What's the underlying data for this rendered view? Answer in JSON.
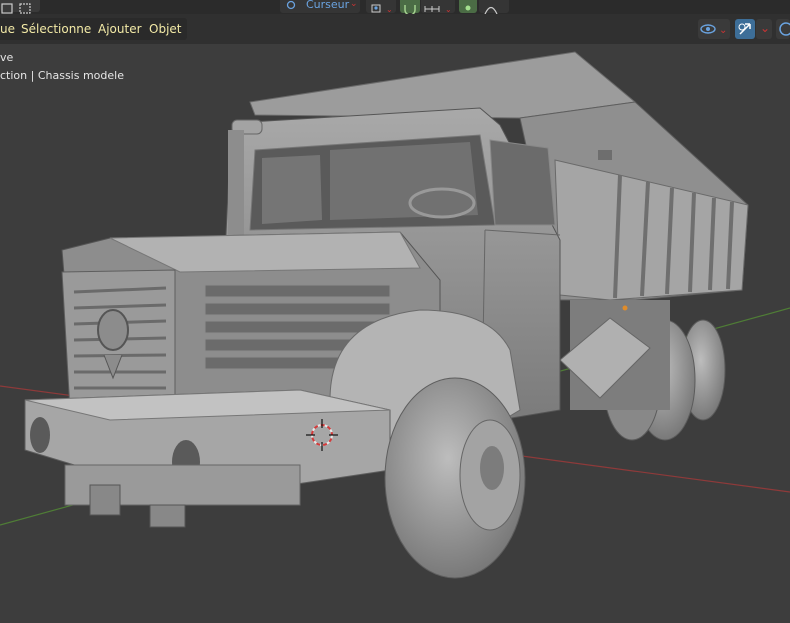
{
  "header": {
    "menu": [
      "ue",
      "Sélectionner",
      "Ajouter",
      "Objet"
    ],
    "pivot_label": "Curseur"
  },
  "overlay": {
    "line1": "ve",
    "line2": "ction | Chassis modele"
  },
  "colors": {
    "header_bg": "#303030",
    "menu_text": "#f2e9a6",
    "viewport_bg": "#3d3d3d",
    "x_axis": "#9c3b3b",
    "y_axis": "#5d8f3a",
    "accent": "#3d6e98"
  },
  "icons": [
    "view-mode-icon",
    "pivot-point-icon",
    "snap-icon",
    "proportional-editing-icon",
    "visibility-icon",
    "gizmo-icon",
    "overlay-icon",
    "3d-cursor-icon"
  ]
}
